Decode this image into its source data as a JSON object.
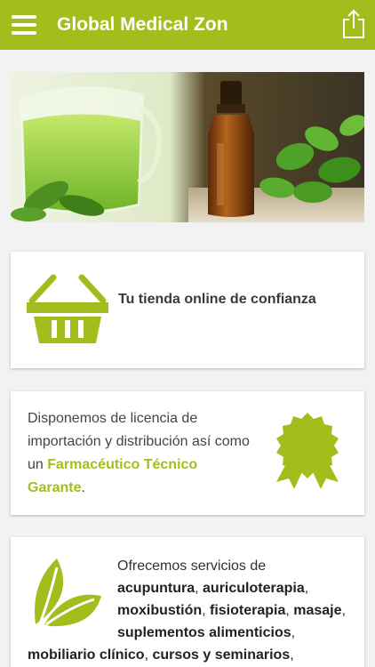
{
  "app_bar": {
    "title": "Global Medical Zon",
    "menu_icon": "hamburger-menu-icon",
    "share_icon": "share-icon",
    "color": "#a4bd1c"
  },
  "hero": {
    "alt": "green tea and essential oil bottle with mint leaves"
  },
  "card_store": {
    "icon": "shopping-basket-icon",
    "text": "Tu tienda online de confianza"
  },
  "card_license": {
    "text_part1": "Disponemos de licencia de importación y distribución así como un ",
    "highlight": "Farmacéutico Técnico Garante",
    "text_part2": ".",
    "icon": "award-badge-icon"
  },
  "card_services": {
    "icon": "leaves-icon",
    "intro": "Ofrecemos servicios de",
    "services_line1": [
      {
        "text": "acupuntura",
        "bold": true
      },
      {
        "text": ", ",
        "bold": false
      },
      {
        "text": "auriculoterapia",
        "bold": true
      },
      {
        "text": ",",
        "bold": false
      }
    ],
    "services_line2": [
      {
        "text": "moxibustión",
        "bold": true
      },
      {
        "text": ", ",
        "bold": false
      },
      {
        "text": "fisioterapia",
        "bold": true
      },
      {
        "text": ", ",
        "bold": false
      },
      {
        "text": "masaje",
        "bold": true
      },
      {
        "text": ",",
        "bold": false
      }
    ],
    "services_line3": [
      {
        "text": "suplementos alimenticios",
        "bold": true
      },
      {
        "text": ",",
        "bold": false
      }
    ],
    "services_line4": [
      {
        "text": "mobiliario clínico",
        "bold": true
      },
      {
        "text": ", ",
        "bold": false
      },
      {
        "text": "cursos y seminarios",
        "bold": true
      },
      {
        "text": ",",
        "bold": false
      }
    ]
  },
  "colors": {
    "accent": "#a4bd1c",
    "background": "#f2f2f2"
  }
}
